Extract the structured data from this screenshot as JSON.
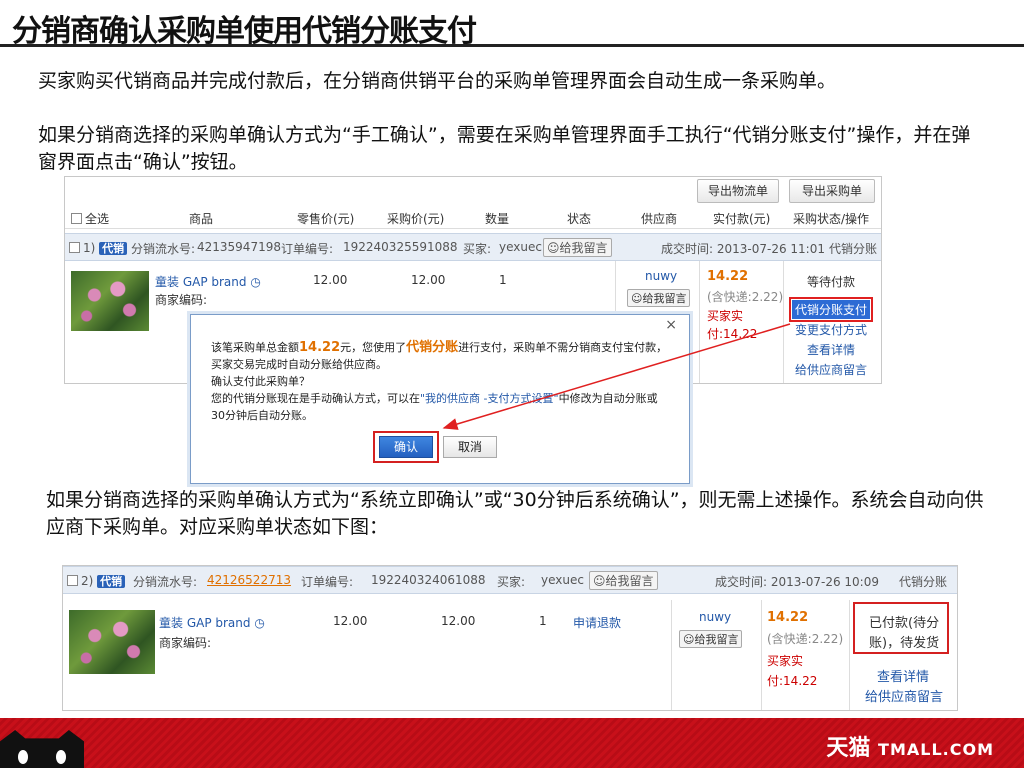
{
  "title": "分销商确认采购单使用代销分账支付",
  "para1": "买家购买代销商品并完成付款后，在分销商供销平台的采购单管理界面会自动生成一条采购单。",
  "para2": "如果分销商选择的采购单确认方式为“手工确认”，需要在采购单管理界面手工执行“代销分账支付”操作，并在弹窗界面点击“确认”按钮。",
  "para3": "如果分销商选择的采购单确认方式为“系统立即确认”或“30分钟后系统确认”，则无需上述操作。系统会自动向供应商下采购单。对应采购单状态如下图：",
  "shot1": {
    "export_logistics": "导出物流单",
    "export_orders": "导出采购单",
    "headers": [
      "全选",
      "商品",
      "零售价(元)",
      "采购价(元)",
      "数量",
      "状态",
      "供应商",
      "实付款(元)",
      "采购状态/操作"
    ],
    "order_index": "1)",
    "tag": "代销",
    "flow_label": "分销流水号:",
    "flow_no": "42135947198",
    "order_label": "订单编号:",
    "order_no": "192240325591088",
    "buyer_label": "买家:",
    "buyer": "yexuec",
    "msg_btn": "给我留言",
    "deal_time": "成交时间: 2013-07-26 11:01",
    "mode": "代销分账",
    "product": "童装 GAP brand",
    "merchant_code": "商家编码:",
    "retail": "12.00",
    "purchase": "12.00",
    "qty": "1",
    "supplier": "nuwy",
    "paid": "14.22",
    "shipping": "(含快递:2.22)",
    "buyer_paid1": "买家实",
    "buyer_paid2": "付:14.22",
    "status": "等待付款",
    "pay_btn": "代销分账支付",
    "change_pay": "变更支付方式",
    "view_detail": "查看详情",
    "msg_supplier": "给供应商留言"
  },
  "dialog": {
    "close": "×",
    "line1_a": "该笔采购单总金额",
    "line1_amount": "14.22",
    "line1_b": "元，您使用了",
    "line1_mode": "代销分账",
    "line1_c": "进行支付，采购单不需分销商支付宝付款，买家交易完成时自动分账给供应商。",
    "line2": "确认支付此采购单？",
    "line3_a": "您的代销分账现在是手动确认方式，可以在",
    "line3_link": "\"我的供应商 -支付方式设置\"",
    "line3_b": "中修改为自动分账或30分钟后自动分账。",
    "confirm": "确认",
    "cancel": "取消"
  },
  "shot2": {
    "order_index": "2)",
    "tag": "代销",
    "flow_label": "分销流水号:",
    "flow_no": "42126522713",
    "order_label": "订单编号:",
    "order_no": "192240324061088",
    "buyer_label": "买家:",
    "buyer": "yexuec",
    "msg_btn": "给我留言",
    "deal_time": "成交时间: 2013-07-26 10:09",
    "mode": "代销分账",
    "product": "童装 GAP brand",
    "merchant_code": "商家编码:",
    "retail": "12.00",
    "purchase": "12.00",
    "qty": "1",
    "refund": "申请退款",
    "supplier": "nuwy",
    "paid": "14.22",
    "shipping": "(含快递:2.22)",
    "buyer_paid1": "买家实",
    "buyer_paid2": "付:14.22",
    "status1": "已付款(待分",
    "status2": "账)，待发货",
    "view_detail": "查看详情",
    "msg_supplier": "给供应商留言"
  },
  "footer": {
    "brand_cn": "天猫",
    "brand_en": "TMALL.COM"
  },
  "colors": {
    "accent_red": "#c8101a",
    "link_blue": "#2358a8",
    "price_orange": "#e07000"
  }
}
